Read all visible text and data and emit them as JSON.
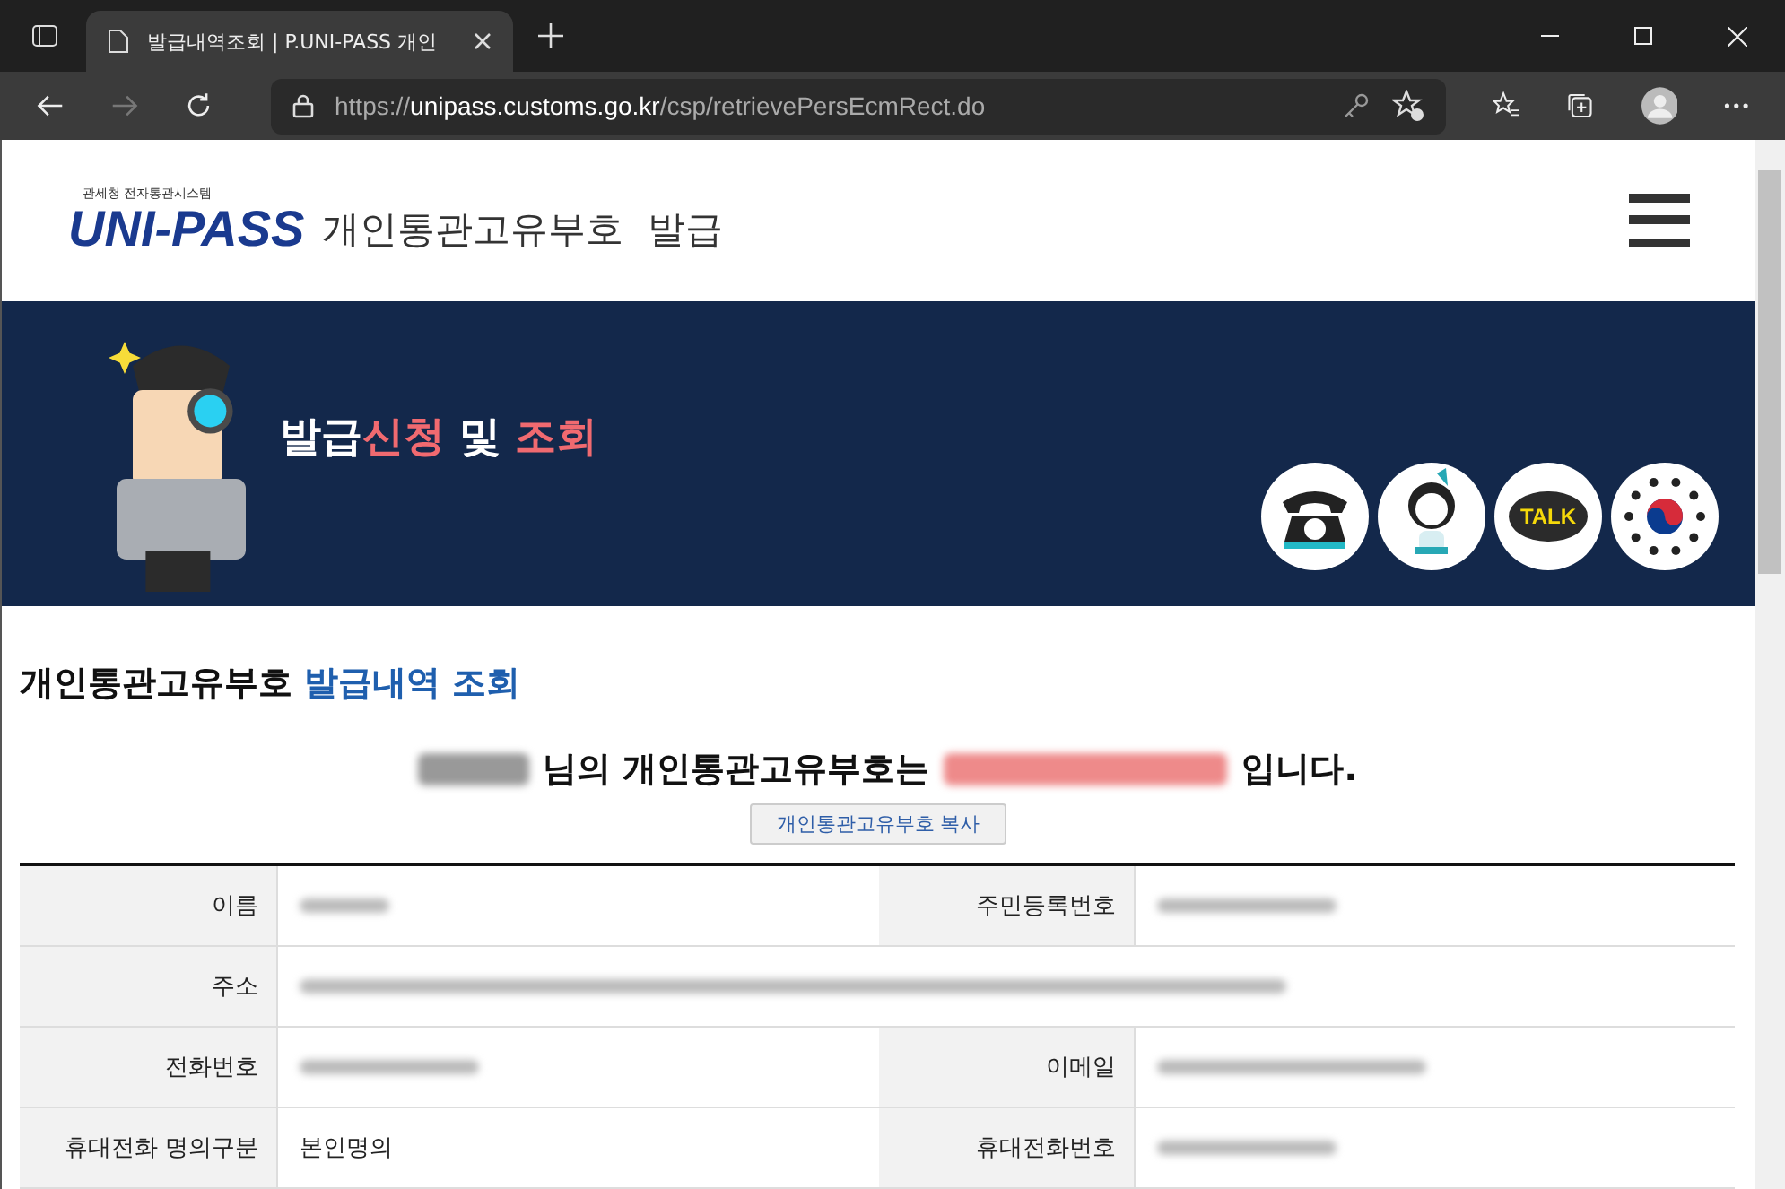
{
  "browser": {
    "tab_title": "발급내역조회 | P.UNI-PASS 개인",
    "url": {
      "scheme": "https://",
      "host": "unipass.customs.go.kr",
      "path": "/csp/retrievePersEcmRect.do"
    }
  },
  "header": {
    "logo_caption": "관세청 전자통관시스템",
    "logo": "UNI-PASS",
    "title": "개인통관고유부호  발급"
  },
  "banner": {
    "headline": [
      {
        "text": "발급",
        "accent": false
      },
      {
        "text": "신청",
        "accent": true
      },
      {
        "text": " 및 ",
        "accent": false
      },
      {
        "text": "조회",
        "accent": true
      }
    ],
    "icons": [
      {
        "kind": "phone"
      },
      {
        "kind": "chatbot"
      },
      {
        "kind": "talk",
        "label": "TALK"
      },
      {
        "kind": "emblem"
      }
    ]
  },
  "section": {
    "title": [
      {
        "text": "개인통관고유부호 ",
        "accent": false
      },
      {
        "text": "발급내역 조회",
        "accent": true
      }
    ],
    "sentence": [
      {
        "kind": "redacted",
        "color": "#999999"
      },
      {
        "kind": "text",
        "text": "님의 개인통관고유부호는"
      },
      {
        "kind": "redacted",
        "color": "#ee8a8a"
      },
      {
        "kind": "text",
        "text": "입니다."
      }
    ],
    "copy_button": "개인통관고유부호 복사"
  },
  "table": {
    "rows": [
      {
        "cells": [
          {
            "label": "이름",
            "redacted": true
          },
          {
            "label": "주민등록번호",
            "redacted": true
          }
        ]
      },
      {
        "cells": [
          {
            "label": "주소",
            "redacted": true
          }
        ]
      },
      {
        "cells": [
          {
            "label": "전화번호",
            "redacted": true
          },
          {
            "label": "이메일",
            "redacted": true
          }
        ]
      },
      {
        "cells": [
          {
            "label": "휴대전화 명의구분",
            "redacted": false,
            "value": "본인명의"
          },
          {
            "label": "휴대전화번호",
            "redacted": true
          }
        ]
      }
    ]
  }
}
